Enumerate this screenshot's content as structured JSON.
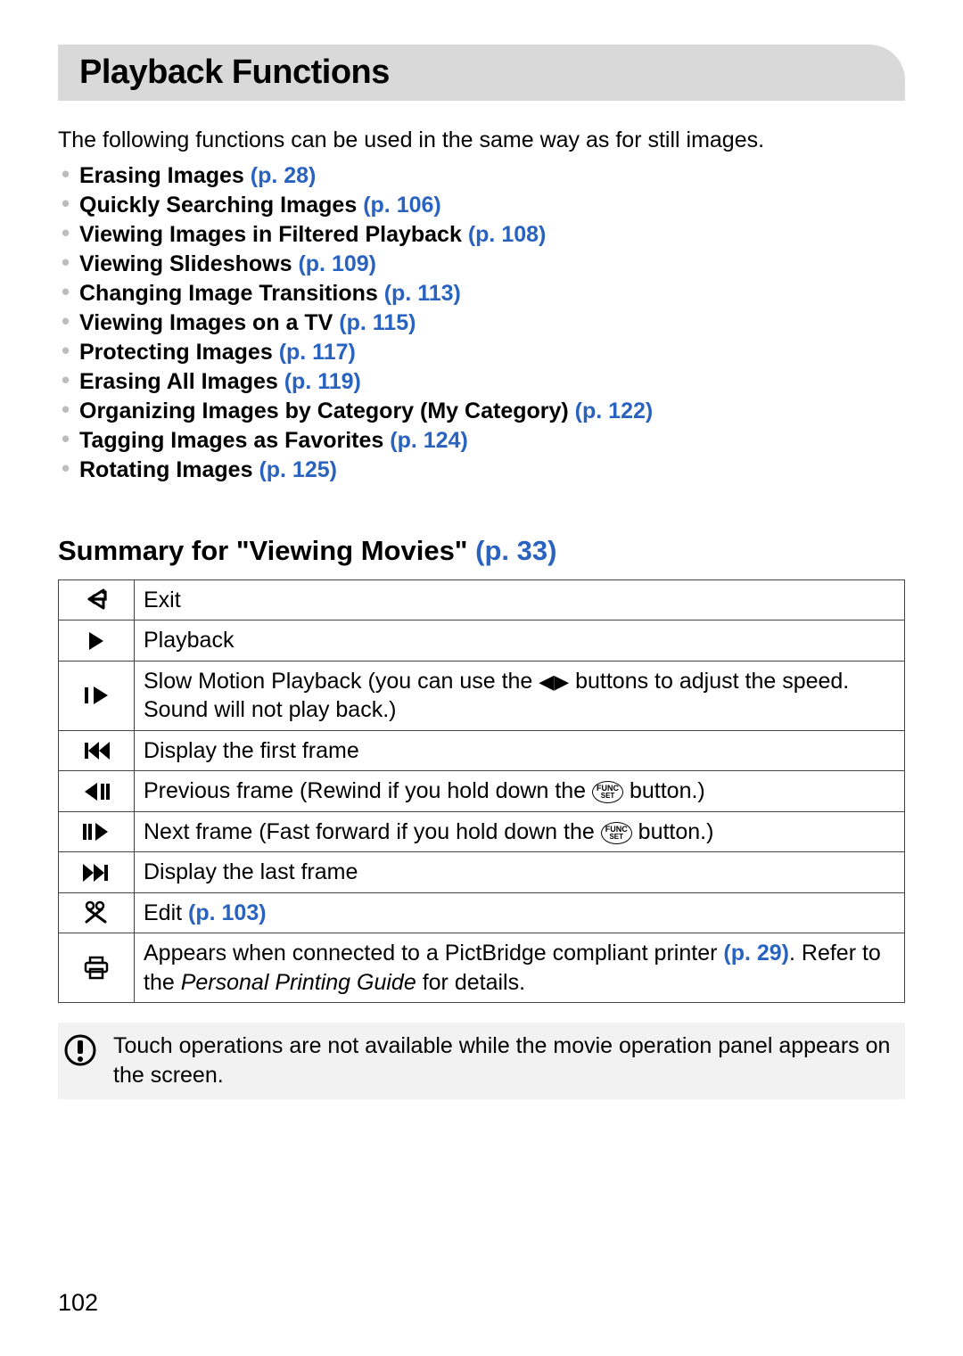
{
  "header": {
    "title": "Playback Functions"
  },
  "intro": "The following functions can be used in the same way as for still images.",
  "functions": [
    {
      "label": "Erasing Images",
      "ref": "(p. 28)"
    },
    {
      "label": "Quickly Searching Images",
      "ref": "(p. 106)"
    },
    {
      "label": "Viewing Images in Filtered Playback",
      "ref": "(p. 108)"
    },
    {
      "label": "Viewing Slideshows",
      "ref": "(p. 109)"
    },
    {
      "label": "Changing Image Transitions",
      "ref": "(p. 113)"
    },
    {
      "label": "Viewing Images on a TV",
      "ref": "(p. 115)"
    },
    {
      "label": "Protecting Images",
      "ref": "(p. 117)"
    },
    {
      "label": "Erasing All Images",
      "ref": "(p. 119)"
    },
    {
      "label": "Organizing Images by Category (My Category)",
      "ref": "(p. 122)"
    },
    {
      "label": "Tagging Images as Favorites",
      "ref": "(p. 124)"
    },
    {
      "label": "Rotating Images",
      "ref": "(p. 125)"
    }
  ],
  "subheading": {
    "label": "Summary for \"Viewing Movies\"",
    "ref": "(p. 33)"
  },
  "table": [
    {
      "icon": "return-icon",
      "desc": {
        "t": "Exit"
      }
    },
    {
      "icon": "play-icon",
      "desc": {
        "t": "Playback"
      }
    },
    {
      "icon": "slow-play-icon",
      "desc": {
        "pre": "Slow Motion Playback (you can use the ",
        "mid": " buttons to adjust the speed. Sound will not play back.)"
      }
    },
    {
      "icon": "first-frame-icon",
      "desc": {
        "t": "Display the first frame"
      }
    },
    {
      "icon": "prev-frame-icon",
      "desc": {
        "pre": "Previous frame (Rewind if you hold down the ",
        "post": " button.)"
      }
    },
    {
      "icon": "next-frame-icon",
      "desc": {
        "pre": "Next frame (Fast forward if you hold down the ",
        "post": " button.)"
      }
    },
    {
      "icon": "last-frame-icon",
      "desc": {
        "t": "Display the last frame"
      }
    },
    {
      "icon": "edit-icon",
      "desc": {
        "t": "Edit ",
        "ref": "(p. 103)"
      }
    },
    {
      "icon": "print-icon",
      "desc": {
        "pre": "Appears when connected to a PictBridge compliant printer ",
        "ref": "(p. 29)",
        "post1": ". Refer to the ",
        "ital": "Personal Printing Guide",
        "post2": " for details."
      }
    }
  ],
  "note": "Touch operations are not available while the movie operation panel appears on the screen.",
  "page_number": "102",
  "func_btn": {
    "l1": "FUNC",
    "l2": "SET"
  },
  "arrows_inline": "◀▶"
}
